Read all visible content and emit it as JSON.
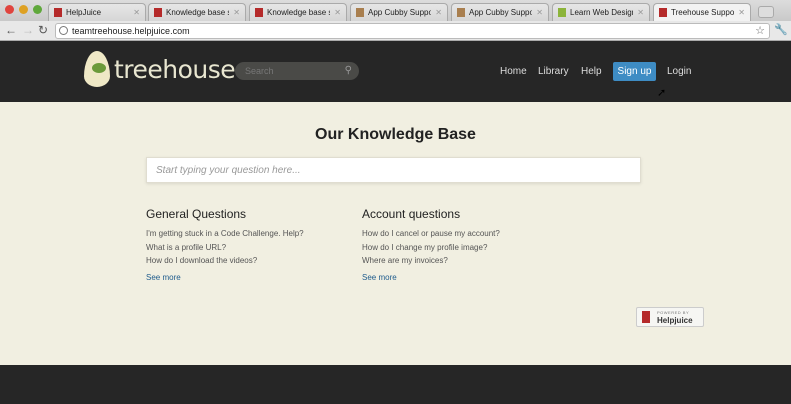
{
  "browser": {
    "tabs": [
      {
        "label": "HelpJuice",
        "icon": "helpjuice-favicon"
      },
      {
        "label": "Knowledge base softw",
        "icon": "helpjuice-favicon"
      },
      {
        "label": "Knowledge base softw",
        "icon": "helpjuice-favicon"
      },
      {
        "label": "App Cubby Support",
        "icon": "appcubby-favicon"
      },
      {
        "label": "App Cubby Support",
        "icon": "appcubby-favicon"
      },
      {
        "label": "Learn Web Design, Wi",
        "icon": "treehouse-favicon"
      },
      {
        "label": "Treehouse Support",
        "icon": "helpjuice-favicon",
        "active": true
      }
    ],
    "url": "teamtreehouse.helpjuice.com"
  },
  "header": {
    "logo": "treehouse",
    "search_placeholder": "Search",
    "nav": [
      "Home",
      "Library",
      "Help"
    ],
    "signup": "Sign up",
    "login": "Login"
  },
  "main": {
    "title": "Our Knowledge Base",
    "question_placeholder": "Start typing your question here...",
    "categories": [
      {
        "title": "General Questions",
        "questions": [
          "I'm getting stuck in a Code Challenge. Help?",
          "What is a profile URL?",
          "How do I download the videos?"
        ],
        "more": "See more"
      },
      {
        "title": "Account questions",
        "questions": [
          "How do I cancel or pause my account?",
          "How do I change my profile image?",
          "Where are my invoices?"
        ],
        "more": "See more"
      }
    ],
    "badge": {
      "powered": "POWERED BY",
      "brand": "Helpjuice"
    }
  }
}
